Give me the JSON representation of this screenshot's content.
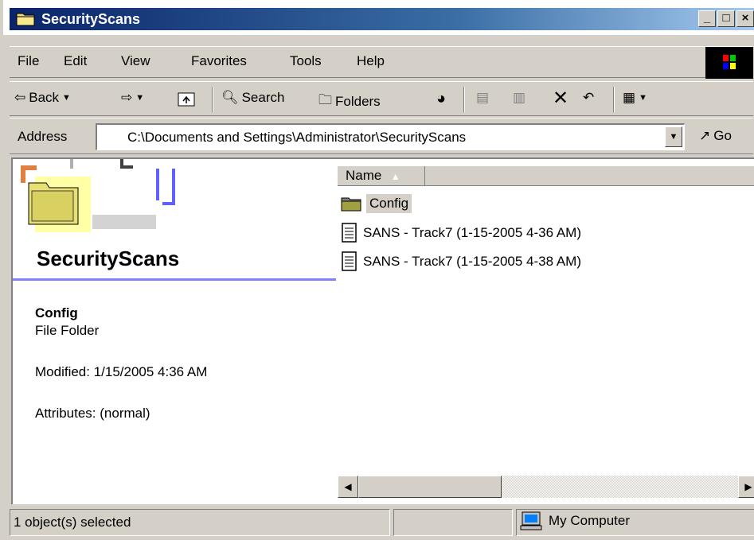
{
  "window": {
    "title": "SecurityScans"
  },
  "menu": [
    "File",
    "Edit",
    "View",
    "Favorites",
    "Tools",
    "Help"
  ],
  "toolbar": {
    "back": "Back",
    "search": "Search",
    "folders": "Folders"
  },
  "address": {
    "label": "Address",
    "value": "C:\\Documents and Settings\\Administrator\\SecurityScans",
    "go": "Go"
  },
  "left_pane": {
    "folder_title": "SecurityScans",
    "selected_name": "Config",
    "selected_type": "File Folder",
    "modified": "Modified: 1/15/2005 4:36 AM",
    "attributes": "Attributes: (normal)"
  },
  "list": {
    "column_name": "Name",
    "items": [
      {
        "name": "Config",
        "icon": "folder-icon"
      },
      {
        "name": "SANS - Track7 (1-15-2005 4-36 AM)",
        "icon": "text-file-icon"
      },
      {
        "name": "SANS - Track7 (1-15-2005 4-38 AM)",
        "icon": "text-file-icon"
      }
    ]
  },
  "status": {
    "selection": "1 object(s) selected",
    "zone": "My Computer"
  }
}
